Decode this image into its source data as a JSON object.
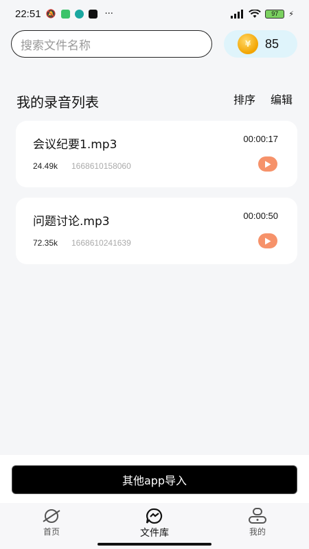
{
  "status_bar": {
    "time": "22:51",
    "battery": "97",
    "more": "···"
  },
  "search": {
    "placeholder": "搜索文件名称"
  },
  "coins": {
    "count": "85"
  },
  "section": {
    "title": "我的录音列表",
    "sort_label": "排序",
    "edit_label": "编辑"
  },
  "recordings": [
    {
      "name": "会议纪要1.mp3",
      "duration": "00:00:17",
      "size": "24.49k",
      "id": "1668610158060"
    },
    {
      "name": "问题讨论.mp3",
      "duration": "00:00:50",
      "size": "72.35k",
      "id": "1668610241639"
    }
  ],
  "import_button_label": "其他app导入",
  "tabs": [
    {
      "label": "首页",
      "icon": "planet-icon",
      "active": false
    },
    {
      "label": "文件库",
      "icon": "chat-wave-icon",
      "active": true
    },
    {
      "label": "我的",
      "icon": "profile-icon",
      "active": false
    }
  ],
  "colors": {
    "accent_play": "#f6926a",
    "coin_pill": "#dff4fb",
    "import_button": "#000000"
  }
}
